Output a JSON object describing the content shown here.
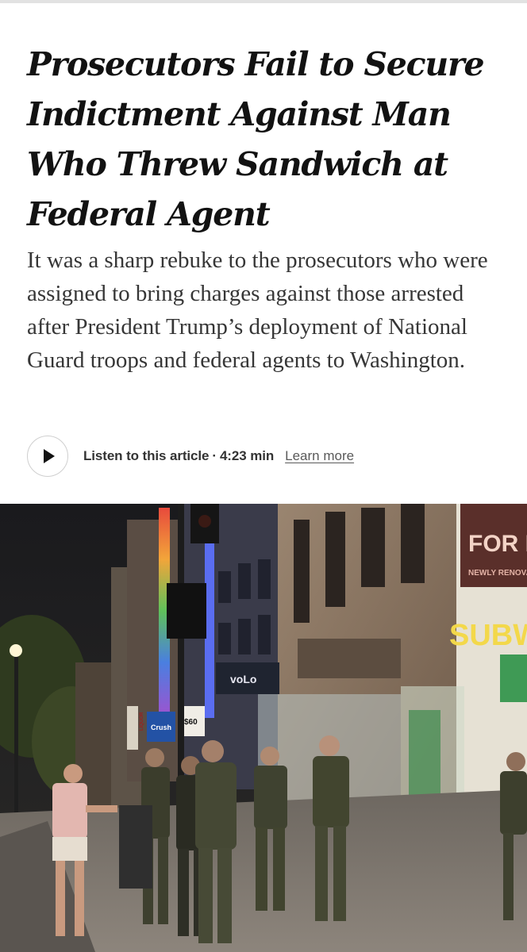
{
  "article": {
    "headline": "Prosecutors Fail to Secure Indictment Against Man Who Threw Sandwich at Federal Agent",
    "summary": "It was a sharp rebuke to the prosecutors who were assigned to bring charges against those arrested after President Trump’s deployment of National Guard troops and federal agents to Washington."
  },
  "audio": {
    "play_icon": "play-icon",
    "label": "Listen to this article",
    "separator": "·",
    "duration": "4:23 min",
    "learn_more": "Learn more"
  },
  "photo": {
    "signs": {
      "store_name": "SUBW",
      "for_lease": "FOR L",
      "now_renovated": "NEWLY RENOVATE",
      "volo": "voLo",
      "crush": "Crush",
      "liquor": "LIQUOR",
      "parking": "$60"
    }
  }
}
